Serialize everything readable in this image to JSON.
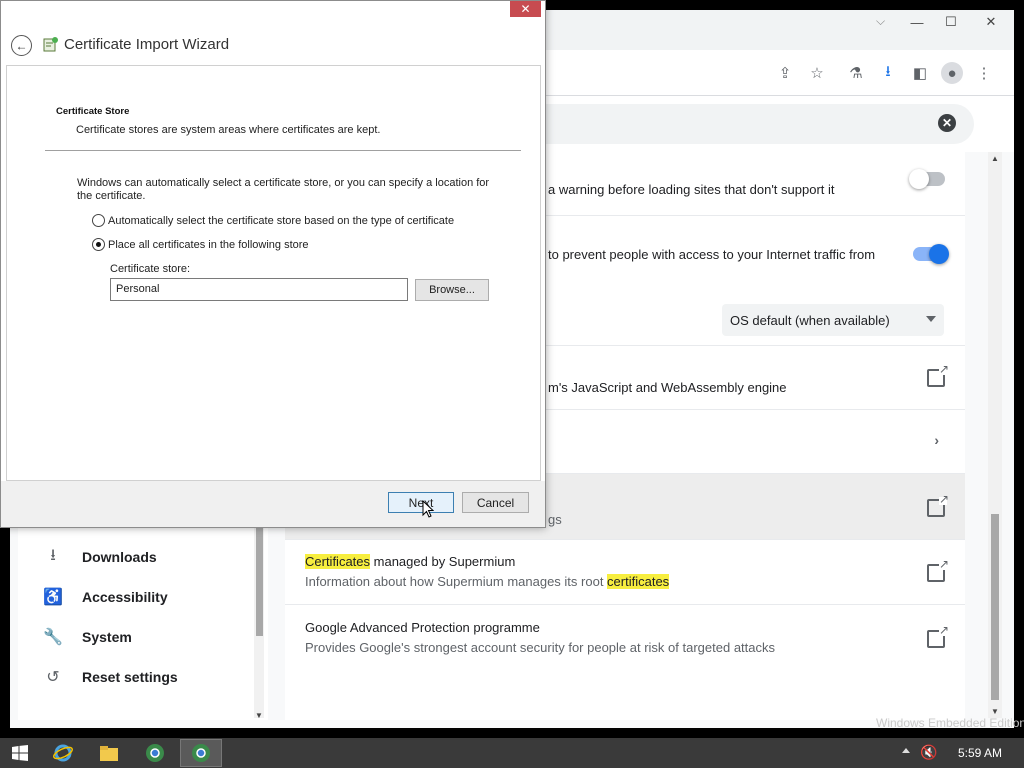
{
  "dialog": {
    "title": "Certificate Import Wizard",
    "section_title": "Certificate Store",
    "section_desc": "Certificate stores are system areas where certificates are kept.",
    "info": "Windows can automatically select a certificate store, or you can specify a location for the certificate.",
    "radio_auto_label": "Automatically select the certificate store based on the type of certificate",
    "radio_place_label": "Place all certificates in the following store",
    "selected_option": "place",
    "store_label": "Certificate store:",
    "store_value": "Personal",
    "browse_label": "Browse...",
    "next_label": "Next",
    "cancel_label": "Cancel",
    "close_glyph": "✕"
  },
  "browser": {
    "rows": {
      "secure_connections_text": "a warning before loading sites that don't support it",
      "secure_dns_text": "to prevent people with access to your Internet traffic from",
      "dns_select_value": "OS default (when available)",
      "v8_text": "m's JavaScript and WebAssembly engine",
      "partial_sub": "gs",
      "certs_title_highlight": "Certificates",
      "certs_title_rest": " managed by Supermium",
      "certs_sub_prefix": "Information about how Supermium manages its root ",
      "certs_sub_highlight": "certificates",
      "gap_title": "Google Advanced Protection programme",
      "gap_sub": "Provides Google's strongest account security for people at risk of targeted attacks"
    },
    "toggles": {
      "secure_connections_on": false,
      "secure_dns_on": true
    },
    "nav": [
      {
        "label": "Downloads",
        "icon": "download-icon"
      },
      {
        "label": "Accessibility",
        "icon": "accessibility-icon"
      },
      {
        "label": "System",
        "icon": "wrench-icon"
      },
      {
        "label": "Reset settings",
        "icon": "history-icon"
      }
    ]
  },
  "watermark": "Windows Embedded Edition",
  "taskbar": {
    "clock": "5:59 AM"
  },
  "colors": {
    "accent": "#1a73e8",
    "highlight": "#f7ee3f",
    "close_red": "#c74b50"
  }
}
